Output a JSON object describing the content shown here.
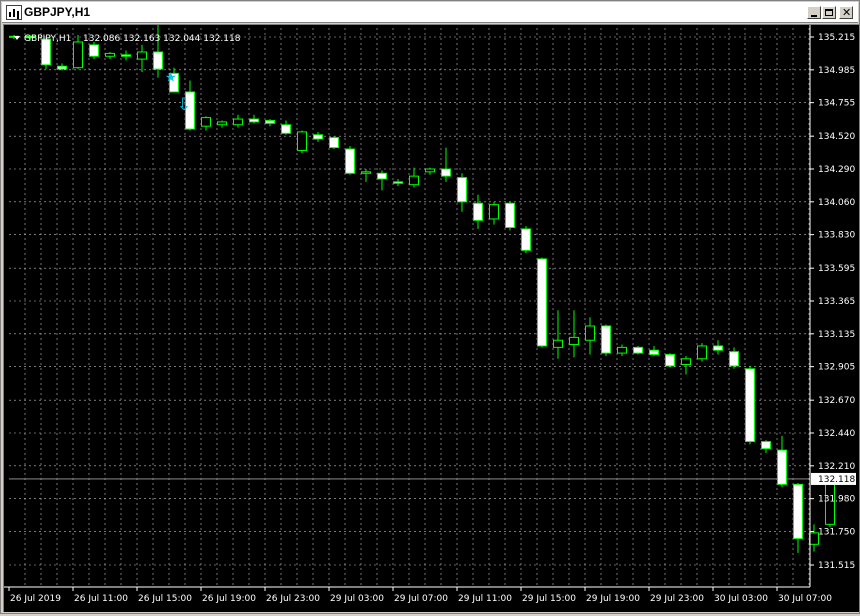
{
  "window": {
    "title": "GBPJPY,H1"
  },
  "chart_data": {
    "type": "candlestick",
    "symbol_label": "GBPJPY,H1",
    "ohlc_label": "132.086 132.163 132.044 132.118",
    "current_price": 132.118,
    "current_price_label": "132.118",
    "ylim": [
      131.48,
      135.32
    ],
    "grid": true,
    "price_ticks": [
      "135.215",
      "134.985",
      "134.755",
      "134.520",
      "134.290",
      "134.060",
      "133.830",
      "133.595",
      "133.365",
      "133.135",
      "132.905",
      "132.670",
      "132.440",
      "132.210",
      "131.980",
      "131.750",
      "131.515"
    ],
    "time_ticks": [
      "26 Jul 2019",
      "26 Jul 11:00",
      "26 Jul 15:00",
      "26 Jul 19:00",
      "26 Jul 23:00",
      "29 Jul 03:00",
      "29 Jul 07:00",
      "29 Jul 11:00",
      "29 Jul 15:00",
      "29 Jul 19:00",
      "29 Jul 23:00",
      "30 Jul 03:00",
      "30 Jul 07:00"
    ],
    "candles": [
      [
        135.22,
        135.23,
        135.2,
        135.22
      ],
      [
        135.22,
        135.23,
        135.19,
        135.21
      ],
      [
        135.2,
        135.21,
        134.99,
        135.02
      ],
      [
        135.01,
        135.03,
        134.98,
        134.99
      ],
      [
        135.0,
        135.23,
        134.99,
        135.18
      ],
      [
        135.16,
        135.18,
        135.06,
        135.08
      ],
      [
        135.08,
        135.11,
        135.06,
        135.1
      ],
      [
        135.09,
        135.12,
        135.05,
        135.08
      ],
      [
        135.06,
        135.16,
        134.97,
        135.11
      ],
      [
        135.11,
        135.31,
        134.93,
        134.99
      ],
      [
        134.96,
        135.0,
        134.83,
        134.83
      ],
      [
        134.83,
        134.91,
        134.56,
        134.57
      ],
      [
        134.59,
        134.66,
        134.56,
        134.65
      ],
      [
        134.6,
        134.63,
        134.58,
        134.62
      ],
      [
        134.6,
        134.67,
        134.58,
        134.64
      ],
      [
        134.64,
        134.67,
        134.61,
        134.62
      ],
      [
        134.63,
        134.64,
        134.59,
        134.61
      ],
      [
        134.6,
        134.63,
        134.53,
        134.54
      ],
      [
        134.42,
        134.56,
        134.4,
        134.55
      ],
      [
        134.53,
        134.55,
        134.48,
        134.5
      ],
      [
        134.51,
        134.52,
        134.43,
        134.44
      ],
      [
        134.43,
        134.45,
        134.25,
        134.26
      ],
      [
        134.26,
        134.29,
        134.2,
        134.27
      ],
      [
        134.26,
        134.28,
        134.14,
        134.22
      ],
      [
        134.2,
        134.22,
        134.17,
        134.19
      ],
      [
        134.18,
        134.3,
        134.16,
        134.24
      ],
      [
        134.27,
        134.3,
        134.25,
        134.29
      ],
      [
        134.29,
        134.44,
        134.2,
        134.24
      ],
      [
        134.23,
        134.26,
        133.99,
        134.06
      ],
      [
        134.05,
        134.11,
        133.87,
        133.93
      ],
      [
        133.94,
        134.06,
        133.9,
        134.04
      ],
      [
        134.05,
        134.06,
        133.86,
        133.88
      ],
      [
        133.87,
        133.89,
        133.7,
        133.72
      ],
      [
        133.66,
        133.67,
        133.04,
        133.05
      ],
      [
        133.04,
        133.3,
        132.96,
        133.09
      ],
      [
        133.06,
        133.3,
        132.97,
        133.11
      ],
      [
        133.09,
        133.25,
        132.99,
        133.19
      ],
      [
        133.19,
        133.2,
        132.98,
        133.0
      ],
      [
        133.0,
        133.06,
        132.98,
        133.04
      ],
      [
        133.04,
        133.05,
        132.99,
        133.0
      ],
      [
        133.02,
        133.05,
        132.98,
        132.99
      ],
      [
        132.99,
        133.0,
        132.9,
        132.91
      ],
      [
        132.92,
        132.98,
        132.85,
        132.96
      ],
      [
        132.96,
        133.07,
        132.94,
        133.05
      ],
      [
        133.05,
        133.09,
        132.99,
        133.02
      ],
      [
        133.01,
        133.04,
        132.89,
        132.91
      ],
      [
        132.89,
        132.91,
        132.36,
        132.38
      ],
      [
        132.38,
        132.39,
        132.3,
        132.33
      ],
      [
        132.32,
        132.42,
        132.06,
        132.08
      ],
      [
        132.08,
        132.09,
        131.6,
        131.7
      ],
      [
        131.66,
        131.8,
        131.61,
        131.74
      ],
      [
        131.8,
        132.12,
        131.78,
        132.11
      ]
    ],
    "annotations": {
      "star_marker": "★",
      "down_arrow_marker": "⇩"
    }
  },
  "colors": {
    "background": "#000000",
    "grid": "#c0c0c0",
    "bull": "#00ff00",
    "bear_fill": "#ffffff",
    "axis_text": "#ffffff",
    "price_line": "#a0a0a0",
    "marker": "#00c8e6"
  }
}
